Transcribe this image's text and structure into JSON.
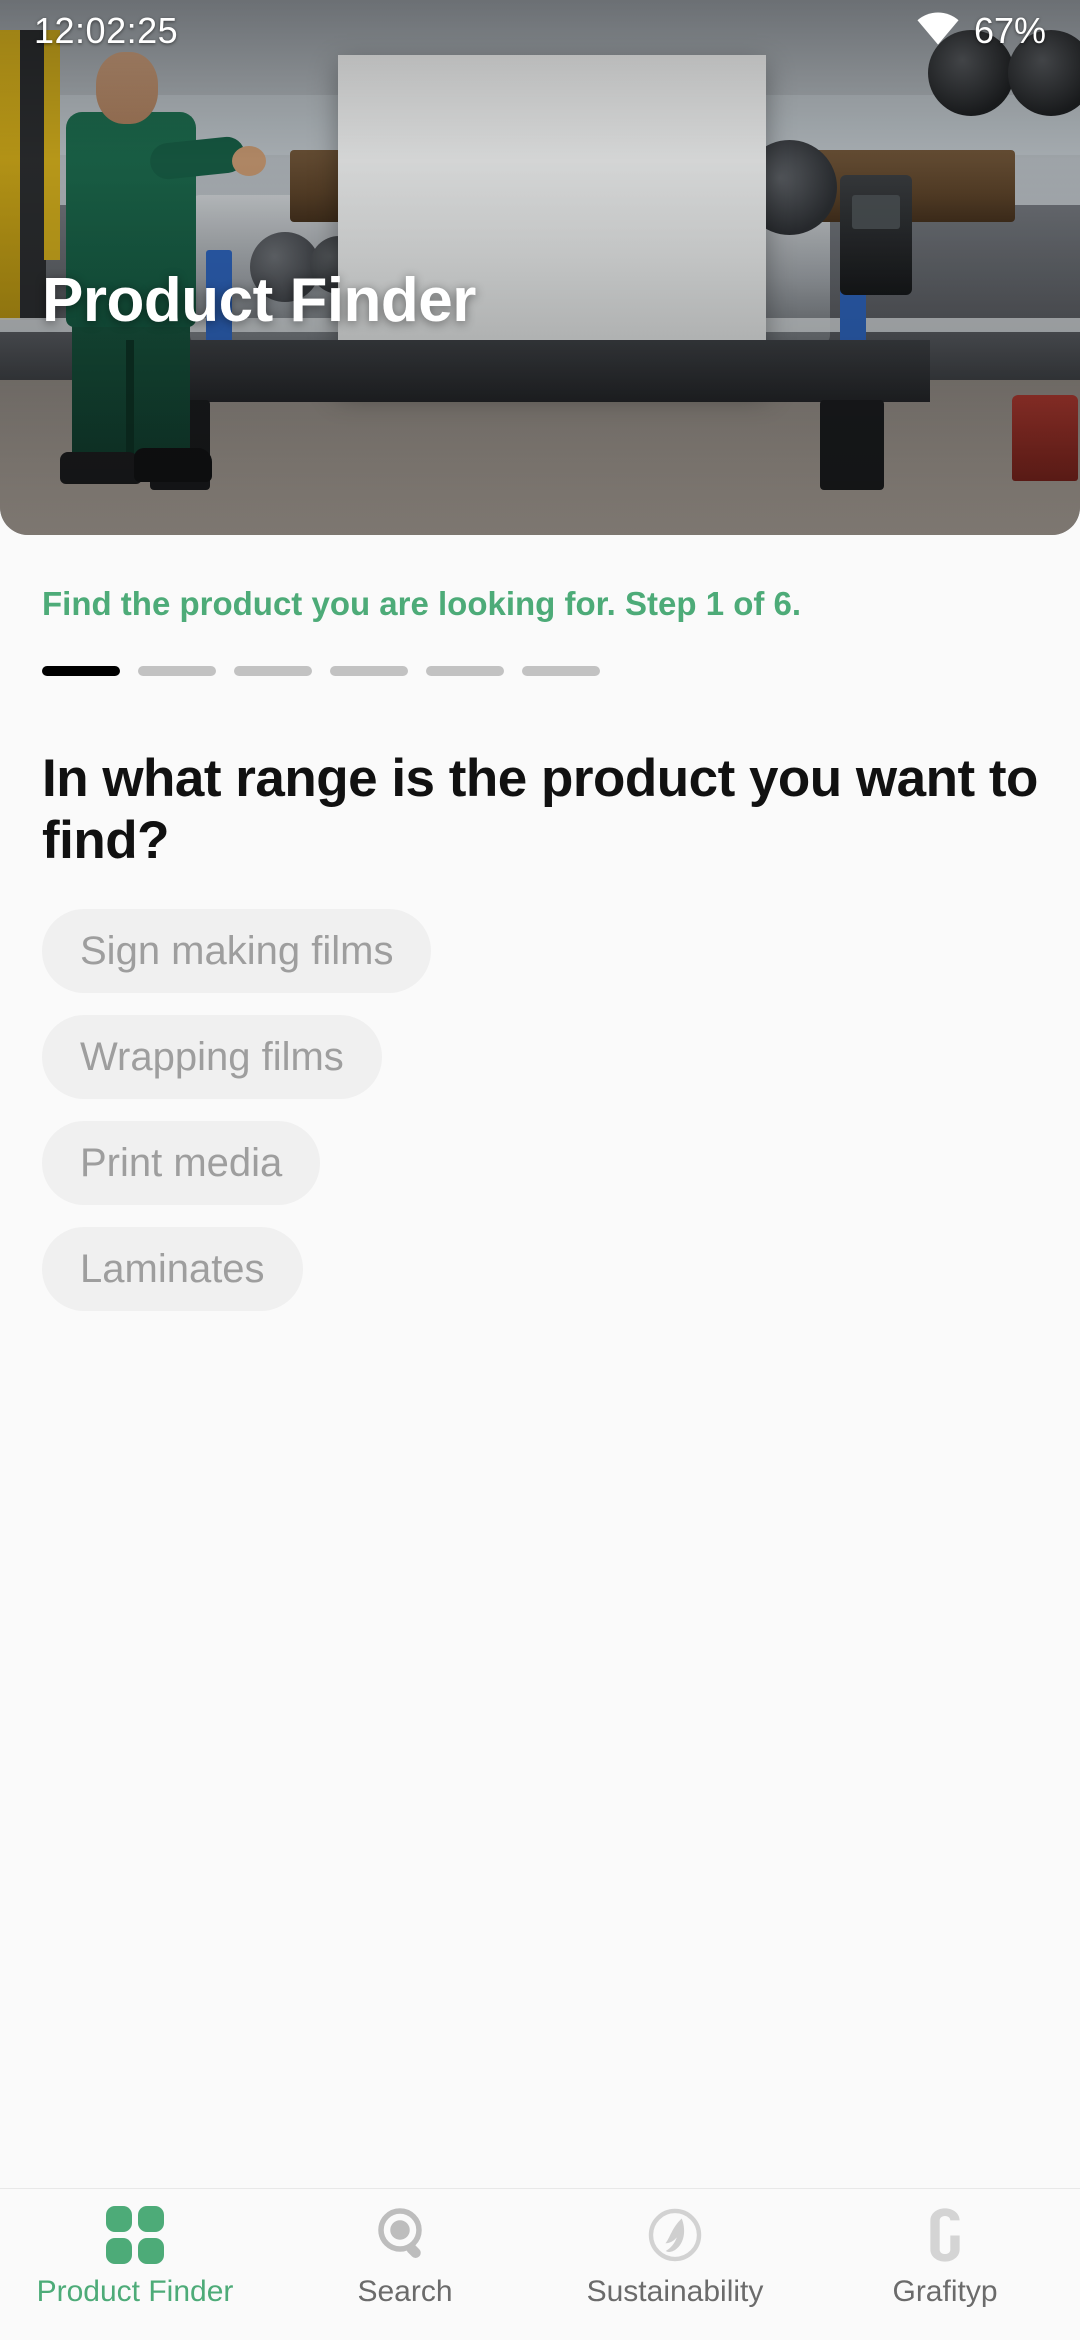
{
  "statusbar": {
    "time": "12:02:25",
    "battery": "67%",
    "wifi_icon": "wifi-icon"
  },
  "hero": {
    "title": "Product Finder",
    "image_alt": "industrial-film-machine-photo"
  },
  "wizard": {
    "subtitle": "Find the product you are looking for. Step 1 of 6.",
    "current_step": 1,
    "total_steps": 6,
    "steps": [
      {
        "index": 1,
        "active": true
      },
      {
        "index": 2,
        "active": false
      },
      {
        "index": 3,
        "active": false
      },
      {
        "index": 4,
        "active": false
      },
      {
        "index": 5,
        "active": false
      },
      {
        "index": 6,
        "active": false
      }
    ],
    "question": "In what range is the product you want to find?",
    "options": [
      {
        "label": "Sign making films"
      },
      {
        "label": "Wrapping films"
      },
      {
        "label": "Print media"
      },
      {
        "label": "Laminates"
      }
    ]
  },
  "bottom_nav": {
    "items": [
      {
        "label": "Product Finder",
        "icon": "grid-four-squares-icon",
        "active": true
      },
      {
        "label": "Search",
        "icon": "magnifier-icon",
        "active": false
      },
      {
        "label": "Sustainability",
        "icon": "leaf-in-circle-icon",
        "active": false
      },
      {
        "label": "Grafityp",
        "icon": "grafityp-g-logo-icon",
        "active": false
      }
    ]
  },
  "colors": {
    "accent_green": "#4dab78",
    "active_step": "#000000",
    "inactive_step": "#c2c2c2",
    "option_bg": "#f0f0f0",
    "option_text": "#9e9e9e",
    "page_bg": "#fafafa"
  }
}
